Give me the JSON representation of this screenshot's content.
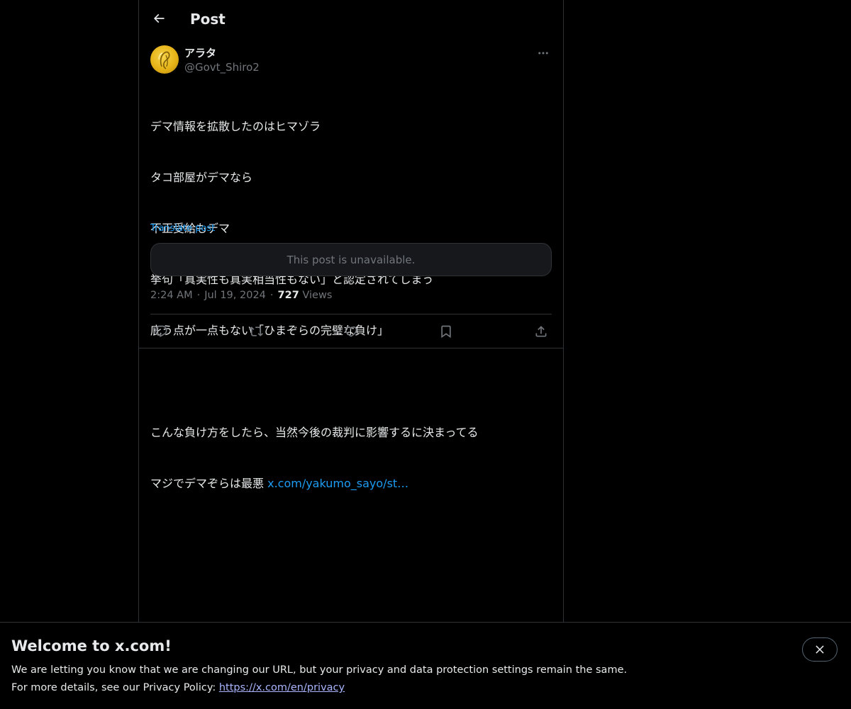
{
  "header": {
    "title": "Post",
    "back_icon": "arrow-left-icon"
  },
  "post": {
    "author_name": "アラタ",
    "author_handle": "@Govt_Shiro2",
    "avatar_icon": "avatar-image",
    "more_icon": "more-horizontal-icon",
    "lines": [
      "デマ情報を拡散したのはヒマゾラ",
      "タコ部屋がデマなら",
      "不正受給もデマ",
      "挙句「真実性も真実相当性もない」と認定されてしまう",
      "庇う点が一点もない「ひまぞらの完璧な負け」",
      "",
      "こんな負け方をしたら、当然今後の裁判に影響するに決まってる"
    ],
    "last_line_text": "マジでデマぞらは最悪 ",
    "link_text": "x.com/yakumo_sayo/st…",
    "translate_label": "Translate post",
    "quoted_unavailable": "This post is unavailable.",
    "time": "2:24 AM",
    "date": "Jul 19, 2024",
    "separator": "·",
    "views_count": "727",
    "views_label": "Views"
  },
  "actions": {
    "reply_icon": "reply-icon",
    "repost_icon": "repost-icon",
    "like_icon": "heart-icon",
    "bookmark_icon": "bookmark-icon",
    "share_icon": "share-icon"
  },
  "banner": {
    "title": "Welcome to x.com!",
    "text1": "We are letting you know that we are changing our URL, but your privacy and data protection settings remain the same.",
    "text2_prefix": "For more details, see our Privacy Policy: ",
    "privacy_link": "https://x.com/en/privacy",
    "close_icon": "close-icon"
  },
  "colors": {
    "background": "#000000",
    "text_primary": "#e7e9ea",
    "text_secondary": "#71767b",
    "accent": "#1d9bf0",
    "border": "#2f3336",
    "banner_link": "#a9b5ff"
  }
}
